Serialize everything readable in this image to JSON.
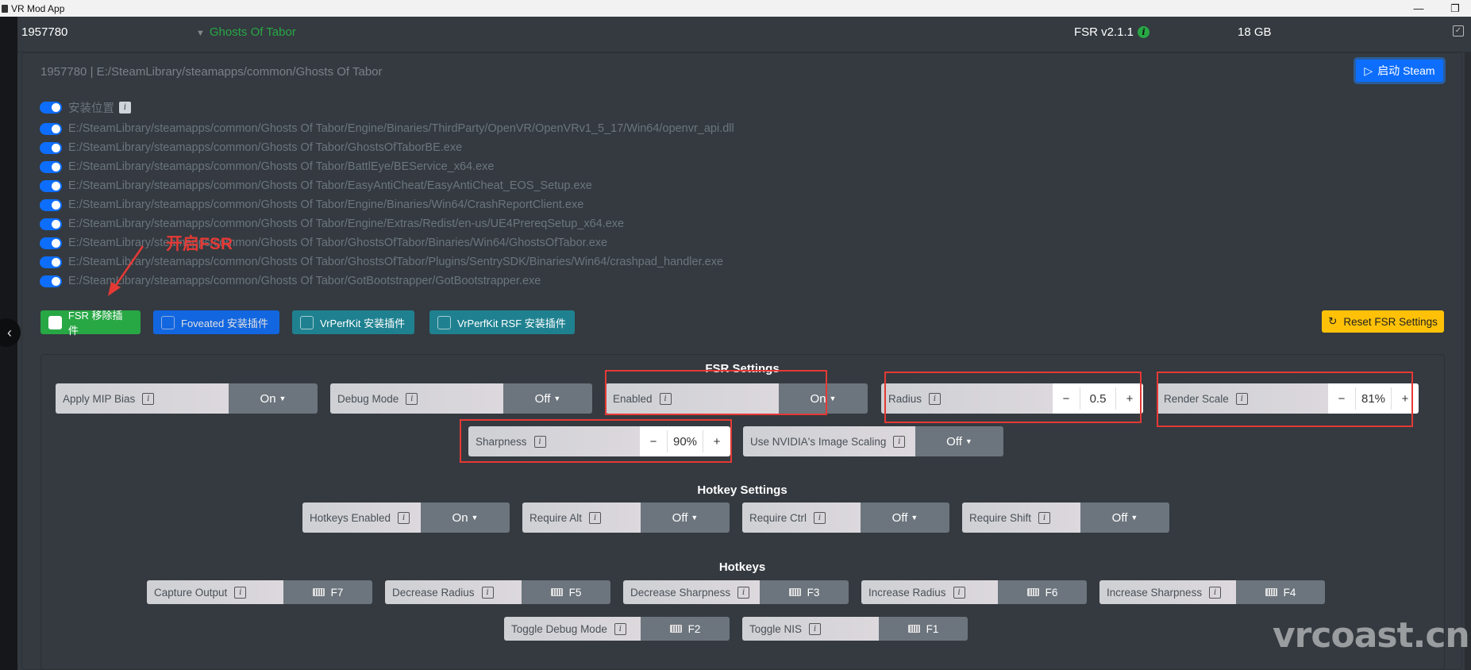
{
  "window": {
    "title": "VR Mod App",
    "minimize_icon": "—",
    "restore_icon": "❐"
  },
  "header": {
    "app_id": "1957780",
    "game_name": "Ghosts Of Tabor",
    "fsr_version": "FSR v2.1.1",
    "size": "18 GB"
  },
  "panel": {
    "path_line": "1957780 | E:/SteamLibrary/steamapps/common/Ghosts Of Tabor",
    "launch_label": "启动 Steam",
    "install_location_label": "安装位置",
    "paths": [
      "E:/SteamLibrary/steamapps/common/Ghosts Of Tabor/Engine/Binaries/ThirdParty/OpenVR/OpenVRv1_5_17/Win64/openvr_api.dll",
      "E:/SteamLibrary/steamapps/common/Ghosts Of Tabor/GhostsOfTaborBE.exe",
      "E:/SteamLibrary/steamapps/common/Ghosts Of Tabor/BattlEye/BEService_x64.exe",
      "E:/SteamLibrary/steamapps/common/Ghosts Of Tabor/EasyAntiCheat/EasyAntiCheat_EOS_Setup.exe",
      "E:/SteamLibrary/steamapps/common/Ghosts Of Tabor/Engine/Binaries/Win64/CrashReportClient.exe",
      "E:/SteamLibrary/steamapps/common/Ghosts Of Tabor/Engine/Extras/Redist/en-us/UE4PrereqSetup_x64.exe",
      "E:/SteamLibrary/steamapps/common/Ghosts Of Tabor/GhostsOfTabor/Binaries/Win64/GhostsOfTabor.exe",
      "E:/SteamLibrary/steamapps/common/Ghosts Of Tabor/GhostsOfTabor/Plugins/SentrySDK/Binaries/Win64/crashpad_handler.exe",
      "E:/SteamLibrary/steamapps/common/Ghosts Of Tabor/GotBootstrapper/GotBootstrapper.exe"
    ],
    "plugin_buttons": [
      {
        "label": "FSR 移除插件",
        "color": "#28a745",
        "checked": true
      },
      {
        "label": "Foveated 安装插件",
        "color": "#0d6efd",
        "checked": false
      },
      {
        "label": "VrPerfKit 安装插件",
        "color": "#1f8190",
        "checked": false
      },
      {
        "label": "VrPerfKit RSF 安装插件",
        "color": "#1f8190",
        "checked": false
      }
    ],
    "reset_label": "Reset FSR Settings"
  },
  "fsr_settings": {
    "title": "FSR Settings",
    "apply_mip_bias": {
      "label": "Apply MIP Bias",
      "value": "On"
    },
    "debug_mode": {
      "label": "Debug Mode",
      "value": "Off"
    },
    "enabled": {
      "label": "Enabled",
      "value": "On"
    },
    "radius": {
      "label": "Radius",
      "value": "0.5"
    },
    "render_scale": {
      "label": "Render Scale",
      "value": "81%"
    },
    "sharpness": {
      "label": "Sharpness",
      "value": "90%"
    },
    "nis": {
      "label": "Use NVIDIA's Image Scaling",
      "value": "Off"
    }
  },
  "hotkey_settings": {
    "title": "Hotkey Settings",
    "items": [
      {
        "label": "Hotkeys Enabled",
        "value": "On"
      },
      {
        "label": "Require Alt",
        "value": "Off"
      },
      {
        "label": "Require Ctrl",
        "value": "Off"
      },
      {
        "label": "Require Shift",
        "value": "Off"
      }
    ]
  },
  "hotkeys": {
    "title": "Hotkeys",
    "items": [
      {
        "label": "Capture Output",
        "key": "F7"
      },
      {
        "label": "Decrease Radius",
        "key": "F5"
      },
      {
        "label": "Decrease Sharpness",
        "key": "F3"
      },
      {
        "label": "Increase Radius",
        "key": "F6"
      },
      {
        "label": "Increase Sharpness",
        "key": "F4"
      },
      {
        "label": "Toggle Debug Mode",
        "key": "F2"
      },
      {
        "label": "Toggle NIS",
        "key": "F1"
      }
    ]
  },
  "annotation": {
    "text": "开启FSR"
  },
  "watermark": "vrcoast.cn",
  "steppers": {
    "minus": "−",
    "plus": "+"
  },
  "info_glyph": "i"
}
